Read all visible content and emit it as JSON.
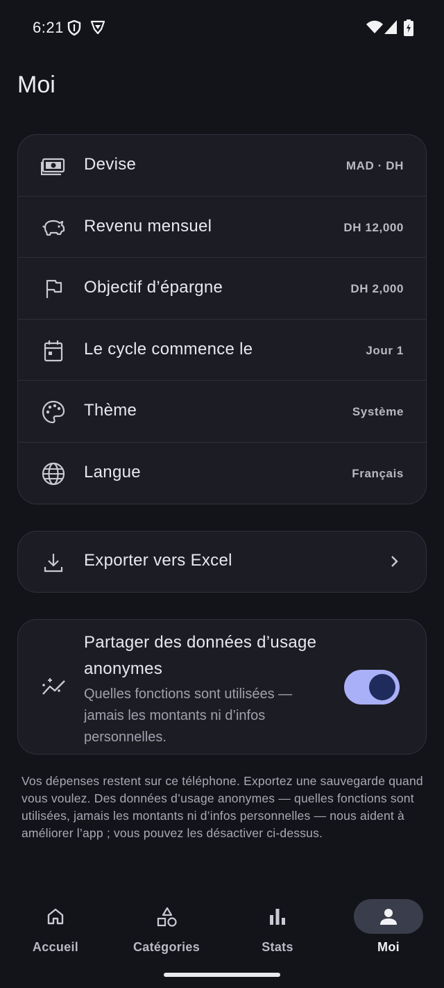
{
  "status_bar": {
    "time": "6:21",
    "icons": [
      "shield-icon",
      "vpn-icon",
      "wifi-icon",
      "cell-signal-icon",
      "battery-charging-icon"
    ]
  },
  "page": {
    "title": "Moi"
  },
  "settings": {
    "items": [
      {
        "icon": "cash-icon",
        "label": "Devise",
        "value": "MAD · DH"
      },
      {
        "icon": "piggy-bank-icon",
        "label": "Revenu mensuel",
        "value": "DH 12,000"
      },
      {
        "icon": "flag-icon",
        "label": "Objectif d’épargne",
        "value": "DH 2,000"
      },
      {
        "icon": "calendar-icon",
        "label": "Le cycle commence le",
        "value": "Jour 1"
      },
      {
        "icon": "palette-icon",
        "label": "Thème",
        "value": "Système"
      },
      {
        "icon": "globe-icon",
        "label": "Langue",
        "value": "Français"
      }
    ]
  },
  "export": {
    "label": "Exporter vers Excel",
    "icon": "download-icon"
  },
  "share": {
    "title": "Partager des données d’usage anonymes",
    "description": "Quelles fonctions sont utilisées — jamais les montants ni d’infos personnelles.",
    "enabled": true,
    "icon": "analytics-icon"
  },
  "footer_note": "Vos dépenses restent sur ce téléphone. Exportez une sauvegarde quand vous voulez. Des données d’usage anonymes — quelles fonctions sont utilisées, jamais les montants ni d’infos personnelles — nous aident à améliorer l’app ; vous pouvez les désactiver ci-dessus.",
  "nav": {
    "items": [
      {
        "label": "Accueil",
        "icon": "home-icon",
        "active": false
      },
      {
        "label": "Catégories",
        "icon": "categories-icon",
        "active": false
      },
      {
        "label": "Stats",
        "icon": "stats-icon",
        "active": false
      },
      {
        "label": "Moi",
        "icon": "person-icon",
        "active": true
      }
    ]
  },
  "colors": {
    "background": "#131419",
    "card": "#1c1d24",
    "toggle_track": "#aab0f7",
    "toggle_knob": "#1f2b5c",
    "nav_active_pill": "#3a3d4b"
  }
}
